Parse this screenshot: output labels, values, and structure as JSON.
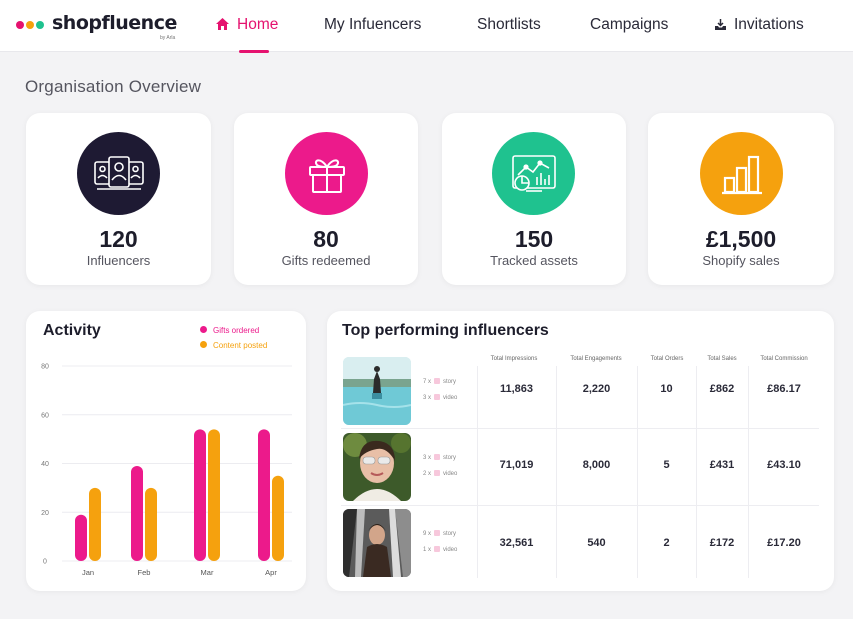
{
  "brand": {
    "name": "shopfluence",
    "tagline": "by Arla",
    "dot_colors": [
      "#e5126f",
      "#f5a10e",
      "#1fc28f"
    ]
  },
  "nav": [
    {
      "label": "Home",
      "icon": "home-icon",
      "active": true
    },
    {
      "label": "My Infuencers",
      "active": false
    },
    {
      "label": "Shortlists",
      "active": false
    },
    {
      "label": "Campaigns",
      "active": false
    },
    {
      "label": "Invitations",
      "icon": "inbox-icon",
      "active": false
    }
  ],
  "page_title": "Organisation Overview",
  "stats": [
    {
      "value": "120",
      "label": "Influencers",
      "color": "#1e1a33",
      "icon": "influencers-icon"
    },
    {
      "value": "80",
      "label": "Gifts redeemed",
      "color": "#ec1a8b",
      "icon": "gift-icon"
    },
    {
      "value": "150",
      "label": "Tracked assets",
      "color": "#1fc28f",
      "icon": "analytics-icon"
    },
    {
      "value": "£1,500",
      "label": "Shopify sales",
      "color": "#f5a10e",
      "icon": "bar-chart-icon"
    }
  ],
  "activity": {
    "title": "Activity",
    "legend": [
      {
        "label": "Gifts ordered",
        "color": "#ec1a8b"
      },
      {
        "label": "Content posted",
        "color": "#f5a10e"
      }
    ]
  },
  "chart_data": {
    "type": "bar",
    "categories": [
      "Jan",
      "Feb",
      "Mar",
      "Apr"
    ],
    "series": [
      {
        "name": "Gifts ordered",
        "values": [
          19,
          39,
          54,
          54
        ]
      },
      {
        "name": "Content posted",
        "values": [
          30,
          30,
          54,
          35
        ]
      }
    ],
    "yticks": [
      "0",
      "20",
      "40",
      "60",
      "80"
    ],
    "ylim": [
      0,
      80
    ],
    "grid": true,
    "legend_position": "top-right"
  },
  "top_influencers": {
    "title": "Top performing influencers",
    "columns": [
      "Total Impressions",
      "Total Engagements",
      "Total Orders",
      "Total Sales",
      "Total Commission"
    ],
    "rows": [
      {
        "posts": [
          {
            "count": "7 x",
            "type": "story"
          },
          {
            "count": "3 x",
            "type": "video"
          }
        ],
        "impressions": "11,863",
        "engagements": "2,220",
        "orders": "10",
        "sales": "£862",
        "commission": "£86.17"
      },
      {
        "posts": [
          {
            "count": "3 x",
            "type": "story"
          },
          {
            "count": "2 x",
            "type": "video"
          }
        ],
        "impressions": "71,019",
        "engagements": "8,000",
        "orders": "5",
        "sales": "£431",
        "commission": "£43.10"
      },
      {
        "posts": [
          {
            "count": "9 x",
            "type": "story"
          },
          {
            "count": "1 x",
            "type": "video"
          }
        ],
        "impressions": "32,561",
        "engagements": "540",
        "orders": "2",
        "sales": "£172",
        "commission": "£17.20"
      }
    ]
  }
}
